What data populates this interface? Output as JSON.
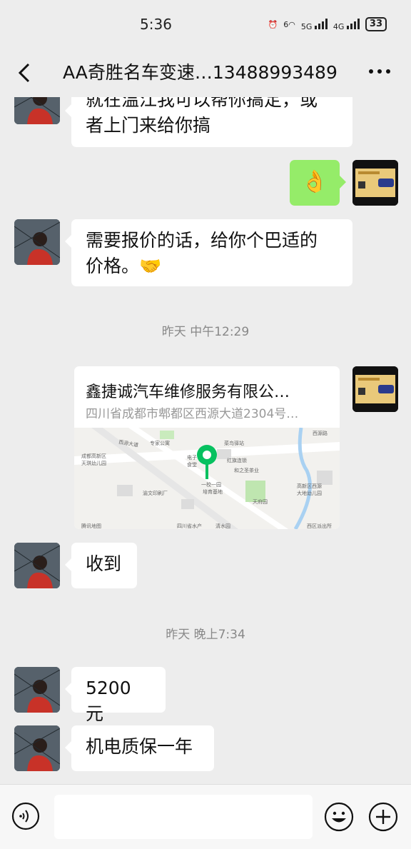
{
  "status": {
    "time": "5:36",
    "net1": "6",
    "net2": "5G",
    "net3": "4G",
    "battery": "33"
  },
  "header": {
    "title": "AA奇胜名车变速…13488993489"
  },
  "messages": {
    "m1_line1": "就在温江我可以帮你搞定，或",
    "m1_line2": "者上门来给你搞",
    "ok_emoji": "👌",
    "m3_line1": "需要报价的话，给你个巴适的",
    "m3_line2": "价格。🤝",
    "ts1": "昨天 中午12:29",
    "location": {
      "name": "鑫捷诚汽车维修服务有限公…",
      "address": "四川省成都市郫都区西源大道2304号…",
      "map_labels": [
        "西源大道",
        "专家公寓",
        "菜鸟驿站",
        "西源路",
        "成都高新区",
        "天琪幼儿园",
        "电子",
        "食堂",
        "红旗连锁",
        "和之圣茶业",
        "一校一园",
        "培育基地",
        "渝文印刷厂",
        "高新区西源",
        "大地幼儿园",
        "天府园",
        "四川省水产",
        "清水园",
        "西区派出所"
      ],
      "map_source": "腾讯地图"
    },
    "m5": "收到",
    "ts2": "昨天 晚上7:34",
    "m6": "5200 元",
    "m7": "机电质保一年"
  },
  "icons": {
    "back": "chevron-left-icon",
    "more": "more-dots-icon",
    "voice": "voice-icon",
    "emoji": "emoji-icon",
    "plus": "plus-icon"
  }
}
